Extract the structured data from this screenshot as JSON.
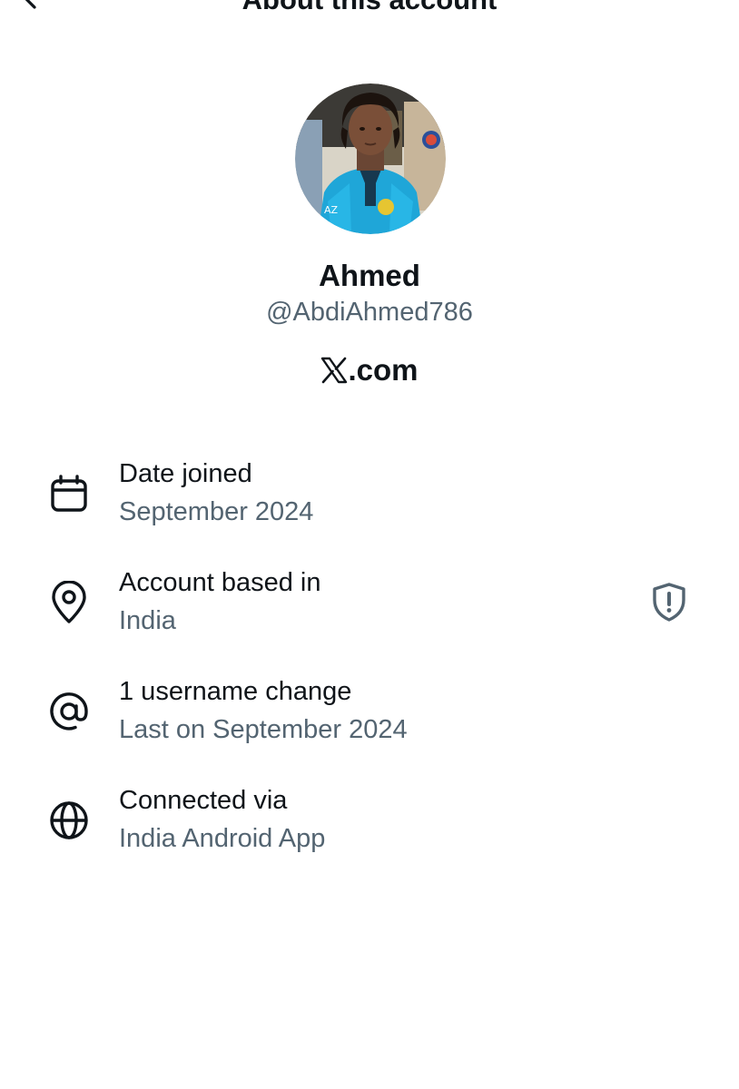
{
  "header": {
    "title": "About this account",
    "back_icon": "arrow-left-icon"
  },
  "profile": {
    "name": "Ahmed",
    "handle": "@AbdiAhmed786",
    "avatar_description": "profile photo",
    "brand_text": ".com",
    "brand_logo": "x-logo"
  },
  "info": {
    "items": [
      {
        "icon": "calendar-icon",
        "label": "Date joined",
        "value": "September 2024"
      },
      {
        "icon": "location-pin-icon",
        "label": "Account based in",
        "value": "India"
      },
      {
        "icon": "at-sign-icon",
        "label": "1 username change",
        "value": "Last on September 2024"
      },
      {
        "icon": "globe-icon",
        "label": "Connected via",
        "value": "India Android App"
      }
    ],
    "badge_icon": "shield-alert-icon"
  },
  "colors": {
    "text_primary": "#0f1419",
    "text_secondary": "#536471",
    "background": "#ffffff",
    "avatar_jacket": "#1fa6d8"
  }
}
